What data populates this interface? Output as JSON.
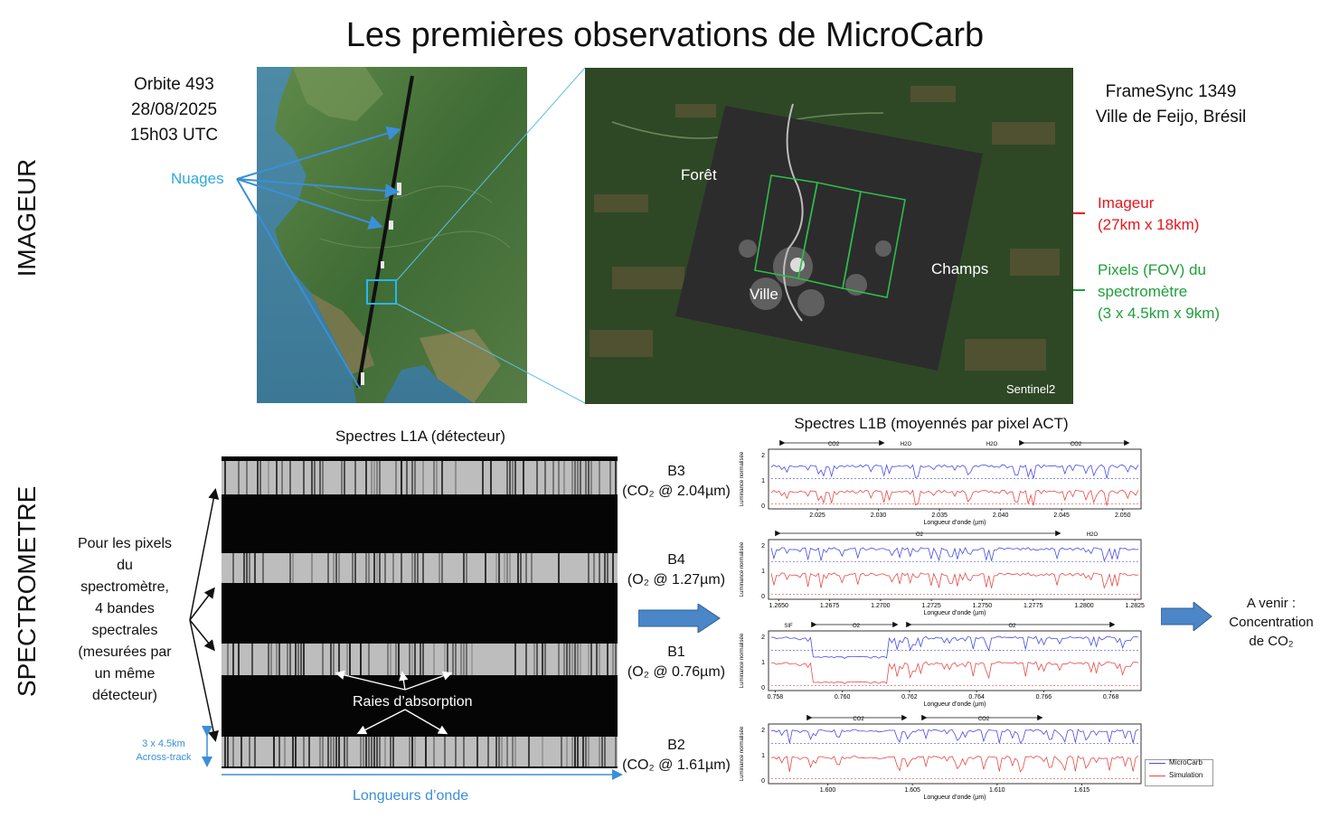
{
  "title": "Les premières observations de MicroCarb",
  "sections": {
    "imageur": "IMAGEUR",
    "spectrometre": "SPECTROMETRE"
  },
  "orbit": {
    "line1": "Orbite 493",
    "line2": "28/08/2025",
    "line3": "15h03 UTC"
  },
  "clouds_label": "Nuages",
  "frame": {
    "line1": "FrameSync 1349",
    "line2": "Ville de Feijo, Brésil"
  },
  "zoom": {
    "foret": "Forêt",
    "ville": "Ville",
    "champs": "Champs",
    "sentinel": "Sentinel2"
  },
  "imager_note": {
    "line1": "Imageur",
    "line2": "(27km x 18km)",
    "color": "#e8141b"
  },
  "pixels_note": {
    "line1": "Pixels (FOV) du",
    "line2": "spectromètre",
    "line3": "(3 x 4.5km x 9km)",
    "color": "#1fa03a"
  },
  "l1a": {
    "title": "Spectres L1A (détecteur)",
    "absorption": "Raies d’absorption",
    "wavelengths": "Longueurs d’onde",
    "across": {
      "line1": "3 x 4.5km",
      "line2": "Across-track"
    }
  },
  "bands_left_text": [
    "Pour les pixels",
    "du",
    "spectromètre,",
    "4 bandes",
    "spectrales",
    "(mesurées par",
    "un même",
    "détecteur)"
  ],
  "bands": [
    {
      "name": "B3",
      "desc": "(CO₂ @ 2.04µm)"
    },
    {
      "name": "B4",
      "desc": "(O₂ @ 1.27µm)"
    },
    {
      "name": "B1",
      "desc": "(O₂ @ 0.76µm)"
    },
    {
      "name": "B2",
      "desc": "(CO₂ @ 1.61µm)"
    }
  ],
  "l1b_title": "Spectres L1B (moyennés par pixel ACT)",
  "future": {
    "line1": "A venir :",
    "line2": "Concentration",
    "line3": "de CO₂"
  },
  "chart_data": [
    {
      "type": "line",
      "ylabel": "Luminance normalisée",
      "xlabel": "Longueur d’onde (µm)",
      "xlim": [
        2.021,
        2.0515
      ],
      "ylim": [
        0,
        2
      ],
      "xticks": [
        "2.025",
        "2.030",
        "2.035",
        "2.040",
        "2.045",
        "2.050"
      ],
      "yticks": [
        "0",
        "1",
        "2"
      ],
      "annotations": [
        "CO2",
        "H2O",
        "H2O",
        "CO2"
      ],
      "series": [
        {
          "name": "MicroCarb",
          "color": "#4a4ae8",
          "level": 1.6
        },
        {
          "name": "Simulation",
          "color": "#e84a4a",
          "level": 0.6
        }
      ]
    },
    {
      "type": "line",
      "ylabel": "Luminance normalisée",
      "xlabel": "Longueur d’onde (µm)",
      "xlim": [
        1.2645,
        1.2828
      ],
      "ylim": [
        0,
        2
      ],
      "xticks": [
        "1.2650",
        "1.2675",
        "1.2700",
        "1.2725",
        "1.2750",
        "1.2775",
        "1.2800",
        "1.2825"
      ],
      "yticks": [
        "0",
        "1",
        "2"
      ],
      "annotations": [
        "O2",
        "H2O"
      ],
      "series": [
        {
          "name": "MicroCarb",
          "color": "#4a4ae8",
          "level": 1.9
        },
        {
          "name": "Simulation",
          "color": "#e84a4a",
          "level": 0.9
        }
      ]
    },
    {
      "type": "line",
      "ylabel": "Luminance normalisée",
      "xlabel": "Longueur d’onde (µm)",
      "xlim": [
        0.7578,
        0.7689
      ],
      "ylim": [
        0,
        2
      ],
      "xticks": [
        "0.758",
        "0.760",
        "0.762",
        "0.764",
        "0.766",
        "0.768"
      ],
      "yticks": [
        "0",
        "1",
        "2"
      ],
      "annotations": [
        "SIF",
        "O2",
        "O2"
      ],
      "series": [
        {
          "name": "MicroCarb",
          "color": "#4a4ae8",
          "level": 2.0
        },
        {
          "name": "Simulation",
          "color": "#e84a4a",
          "level": 1.0
        }
      ]
    },
    {
      "type": "line",
      "ylabel": "Luminance normalisée",
      "xlabel": "Longueur d’onde (µm)",
      "xlim": [
        1.5965,
        1.6185
      ],
      "ylim": [
        0,
        2
      ],
      "xticks": [
        "1.600",
        "1.605",
        "1.610",
        "1.615"
      ],
      "yticks": [
        "0",
        "1",
        "2"
      ],
      "annotations": [
        "CO2",
        "CO2"
      ],
      "series": [
        {
          "name": "MicroCarb",
          "color": "#4a4ae8",
          "level": 2.0
        },
        {
          "name": "Simulation",
          "color": "#e84a4a",
          "level": 0.95
        }
      ],
      "legend": "bottom-right"
    }
  ]
}
